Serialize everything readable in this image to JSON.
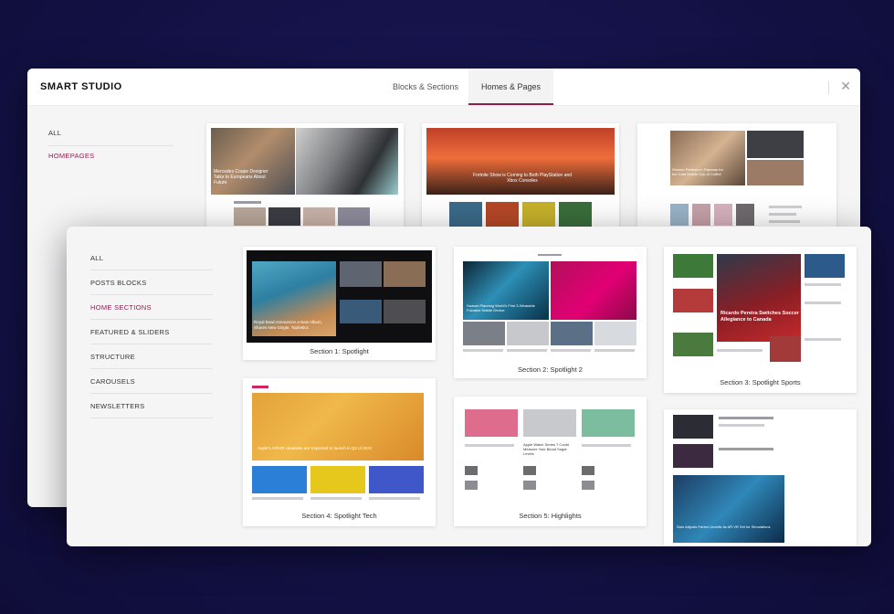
{
  "app": {
    "title": "SMART STUDIO"
  },
  "tabs": [
    {
      "label": "Blocks & Sections",
      "active": false
    },
    {
      "label": "Homes & Pages",
      "active": true
    }
  ],
  "back_sidebar": [
    {
      "label": "ALL",
      "active": false
    },
    {
      "label": "HOMEPAGES",
      "active": true
    }
  ],
  "front_sidebar": [
    {
      "label": "ALL",
      "active": false
    },
    {
      "label": "POSTS BLOCKS",
      "active": false
    },
    {
      "label": "HOME SECTIONS",
      "active": true
    },
    {
      "label": "FEATURED & SLIDERS",
      "active": false
    },
    {
      "label": "STRUCTURE",
      "active": false
    },
    {
      "label": "CAROUSELS",
      "active": false
    },
    {
      "label": "NEWSLETTERS",
      "active": false
    }
  ],
  "back_thumbs": [
    {
      "headline": "Mercedes Coupe Designer Talks to Europeans About Future"
    },
    {
      "headline": "Fortnite Show is Coming to Both PlayStation and Xbox Consoles"
    },
    {
      "headline": "Woman Relaxes in Pajamas for the Café Mobile Cup of Coffee"
    }
  ],
  "sections": [
    {
      "caption": "Section 1: Spotlight",
      "headline": "Royal Bowl Announces a New Album, Shares New Single, Tophetics"
    },
    {
      "caption": "Section 2: Spotlight 2",
      "headline": "Huawei Planning World's First 3-Wearable Foldable Mobile Device"
    },
    {
      "caption": "Section 3: Spotlight Sports",
      "headline": "Ricardo Pereira Switches Soccer Allegiance to Canada"
    },
    {
      "caption": "Section 4: Spotlight Tech",
      "headline": "Apple's AR/VR Headsets are Expected to launch in Q2 of 2022"
    },
    {
      "caption": "Section 5: Highlights",
      "headline": "Apple Watch Series 7 Could Measure Your Blood Sugar Levels"
    },
    {
      "caption": "",
      "headline": "Sam Adjusts Parker Unveils Its AR VR Set for Simulations"
    }
  ],
  "colors": {
    "accent": "#8c1d4f",
    "background": "#15134a"
  },
  "icons": {
    "close": "close-icon"
  }
}
